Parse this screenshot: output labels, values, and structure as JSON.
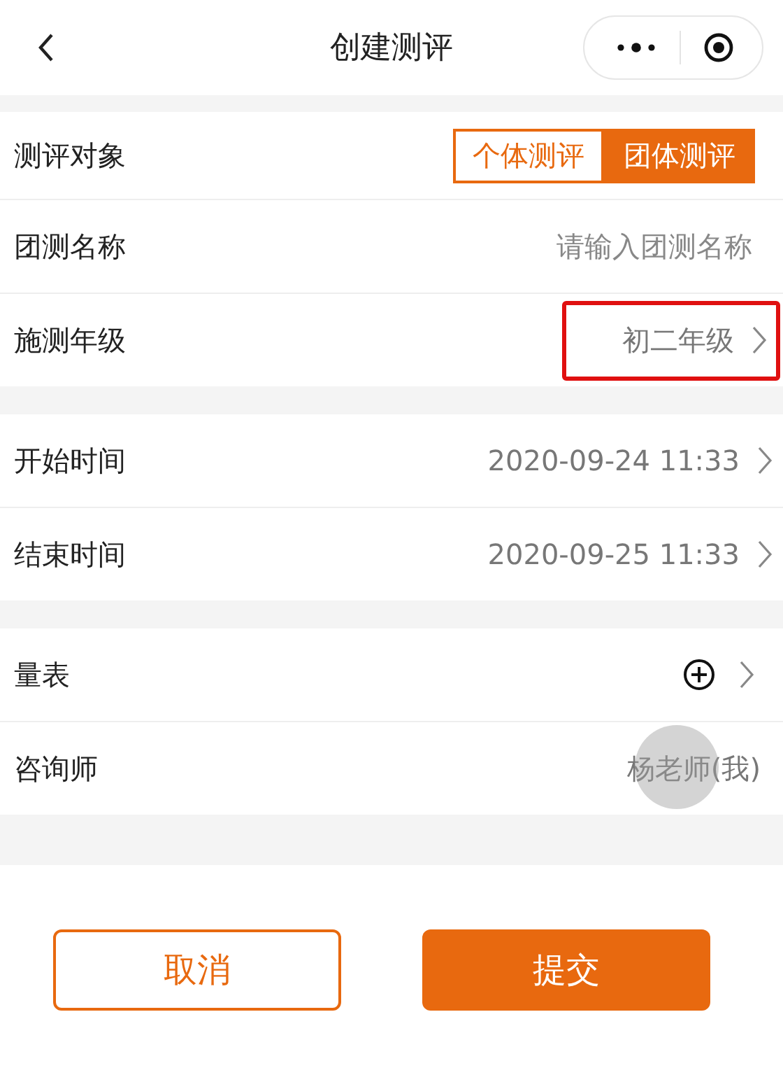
{
  "nav": {
    "title": "创建测评"
  },
  "sections": [
    [
      {
        "kind": "segment",
        "label": "测评对象",
        "options": [
          {
            "label": "个体测评",
            "selected": false
          },
          {
            "label": "团体测评",
            "selected": true
          }
        ]
      },
      {
        "kind": "input",
        "label": "团测名称",
        "placeholder": "请输入团测名称"
      },
      {
        "kind": "select",
        "label": "施测年级",
        "value": "初二年级",
        "highlighted": true
      }
    ],
    [
      {
        "kind": "select",
        "label": "开始时间",
        "value": "2020-09-24 11:33",
        "highlighted": false
      },
      {
        "kind": "select",
        "label": "结束时间",
        "value": "2020-09-25 11:33",
        "highlighted": false
      }
    ],
    [
      {
        "kind": "add",
        "label": "量表"
      },
      {
        "kind": "text",
        "label": "咨询师",
        "value": "杨老师(我)",
        "touched": true
      }
    ]
  ],
  "buttons": [
    {
      "label": "取消",
      "kind": "outline"
    },
    {
      "label": "提交",
      "kind": "primary"
    }
  ]
}
